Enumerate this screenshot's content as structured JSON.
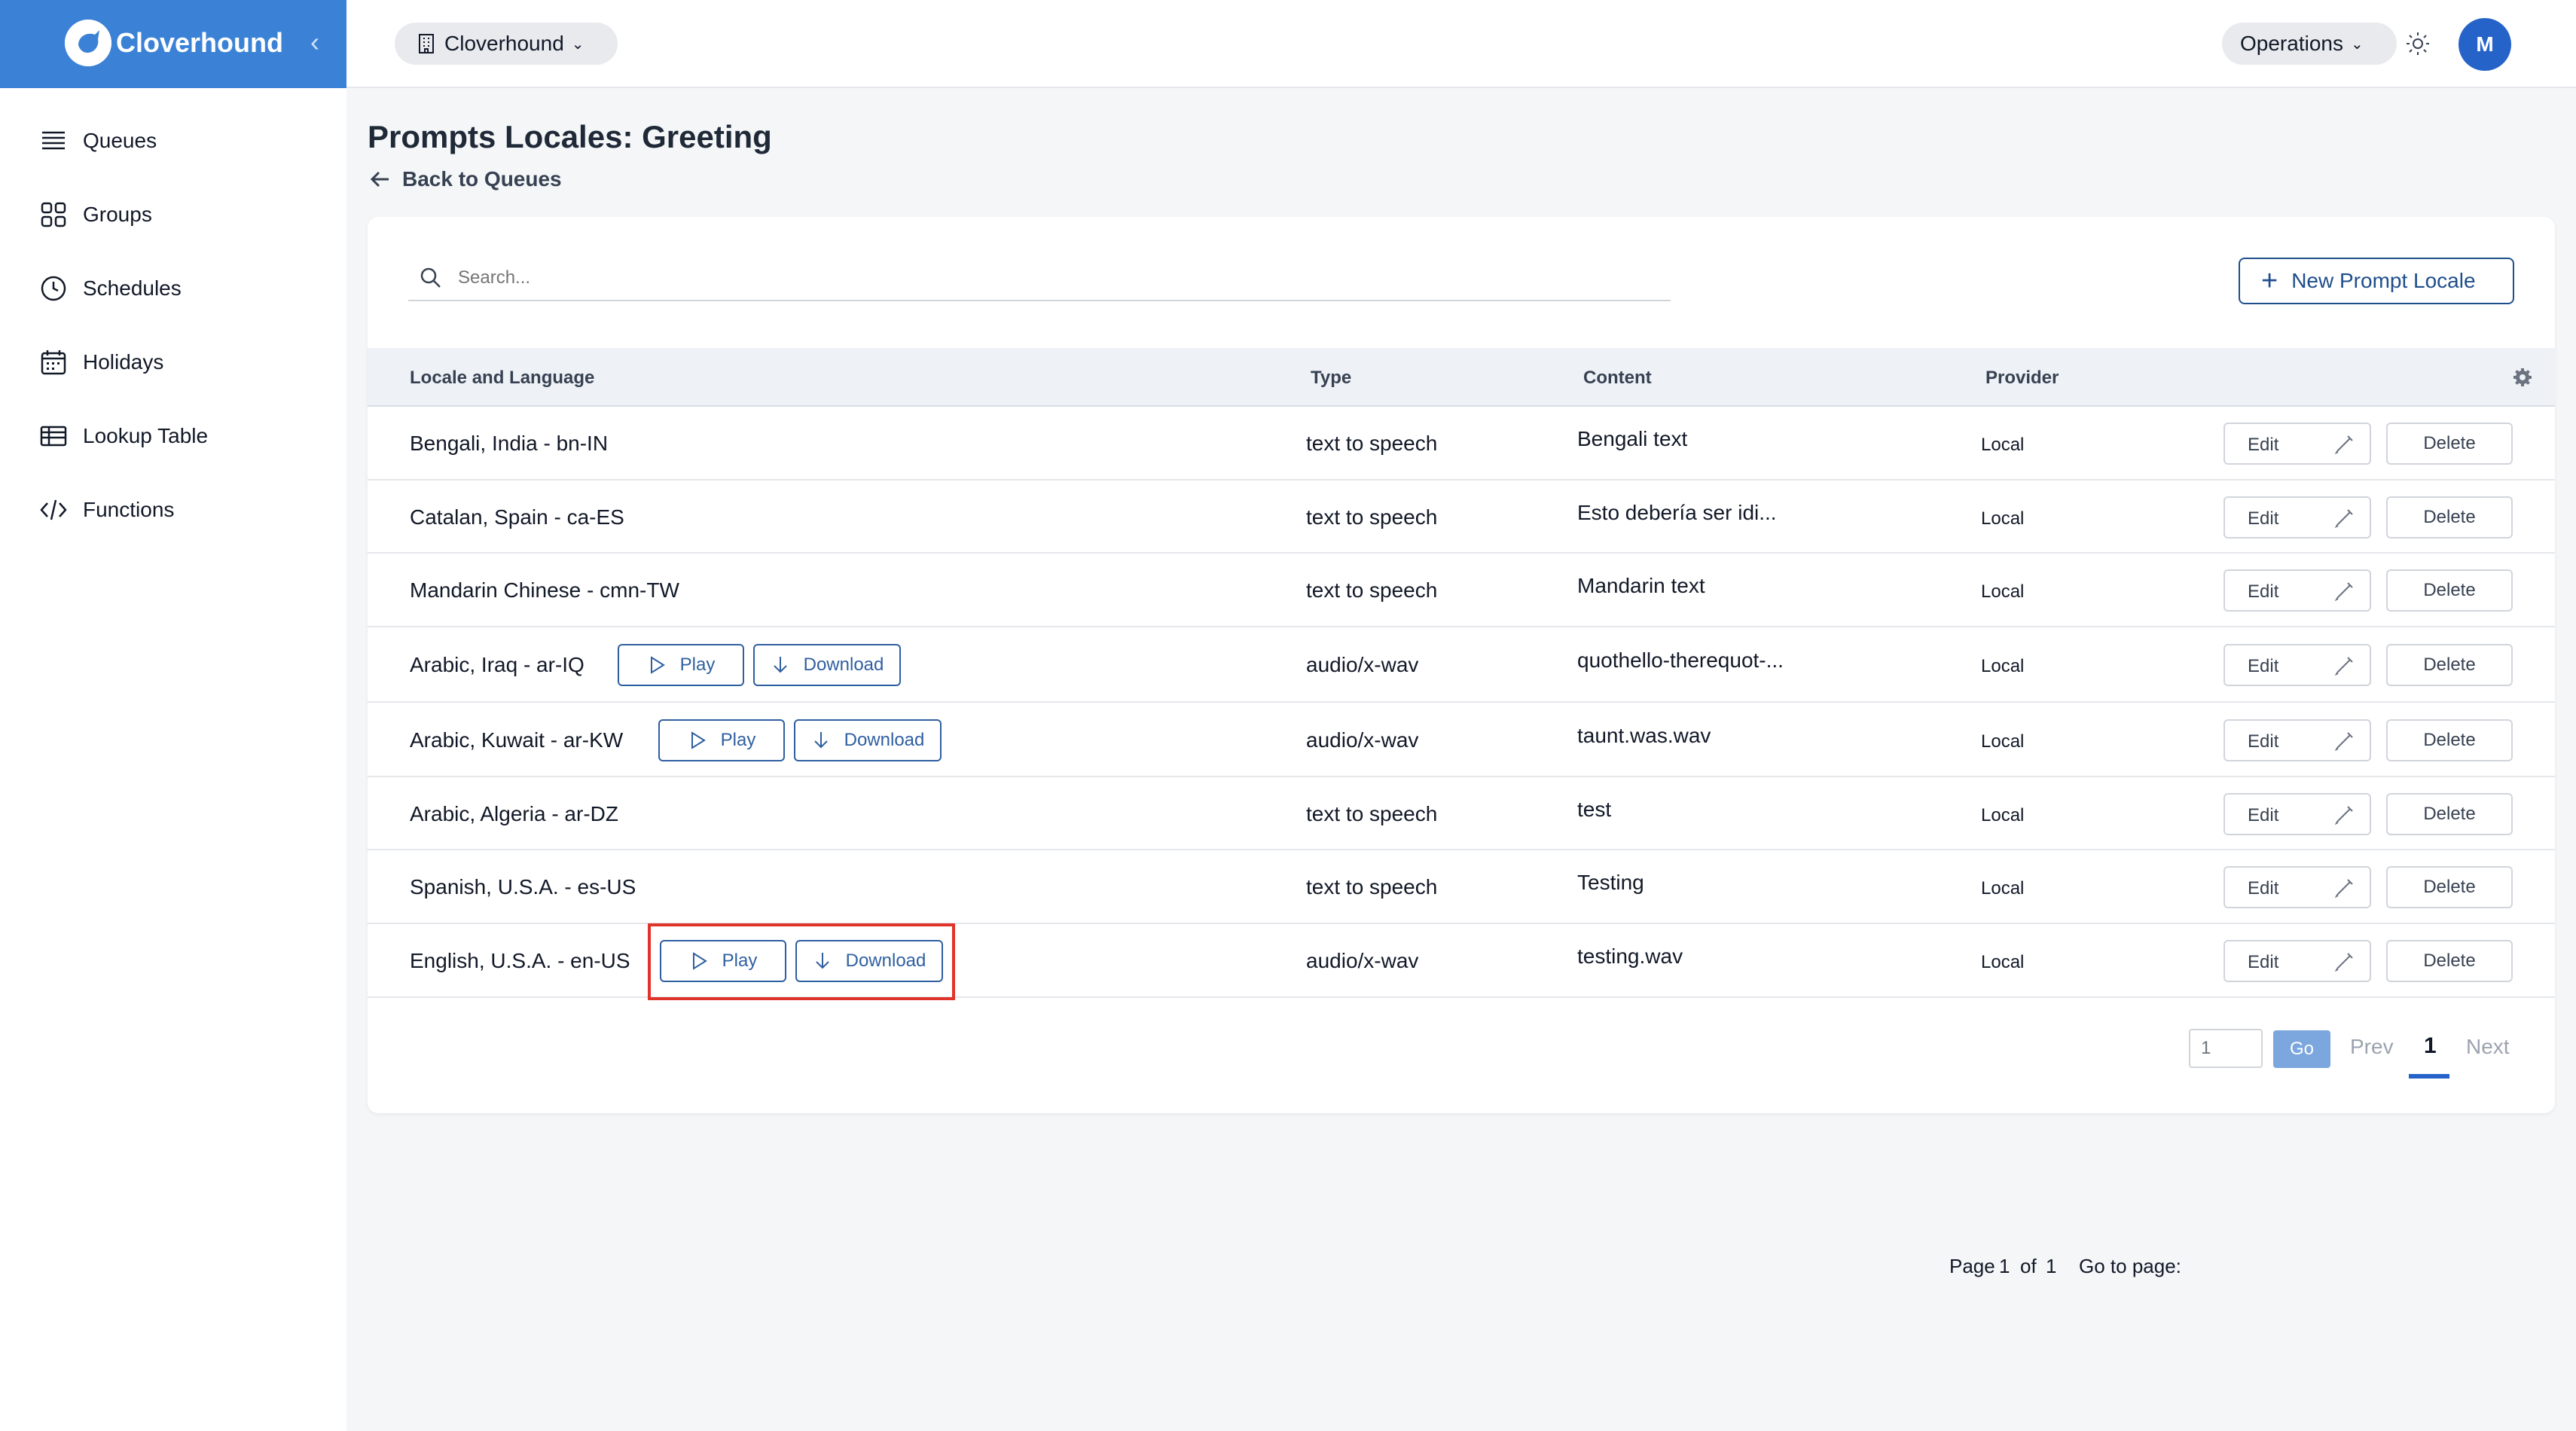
{
  "app": {
    "brand": "Cloverhound",
    "org_selector": "Cloverhound",
    "ops_selector": "Operations",
    "avatar_initial": "M"
  },
  "sidebar": {
    "items": [
      {
        "label": "Queues",
        "icon": "list-icon"
      },
      {
        "label": "Groups",
        "icon": "grid-icon"
      },
      {
        "label": "Schedules",
        "icon": "clock-icon"
      },
      {
        "label": "Holidays",
        "icon": "calendar-icon"
      },
      {
        "label": "Lookup Table",
        "icon": "table-icon"
      },
      {
        "label": "Functions",
        "icon": "code-icon"
      }
    ]
  },
  "page": {
    "title": "Prompts Locales: Greeting",
    "back_label": "Back to Queues"
  },
  "toolbar": {
    "search_placeholder": "Search...",
    "new_button_label": "New Prompt Locale"
  },
  "table": {
    "columns": [
      "Locale and Language",
      "Type",
      "Content",
      "Provider"
    ],
    "rows": [
      {
        "locale": "Bengali, India - bn-IN",
        "type": "text to speech",
        "content": "Bengali text",
        "provider": "Local",
        "audio": false
      },
      {
        "locale": "Catalan, Spain - ca-ES",
        "type": "text to speech",
        "content": "Esto debería ser idi...",
        "provider": "Local",
        "audio": false
      },
      {
        "locale": "Mandarin Chinese - cmn-TW",
        "type": "text to speech",
        "content": "Mandarin text",
        "provider": "Local",
        "audio": false
      },
      {
        "locale": "Arabic, Iraq - ar-IQ",
        "type": "audio/x-wav",
        "content": "quothello-therequot-...",
        "provider": "Local",
        "audio": true
      },
      {
        "locale": "Arabic, Kuwait - ar-KW",
        "type": "audio/x-wav",
        "content": "taunt.was.wav",
        "provider": "Local",
        "audio": true
      },
      {
        "locale": "Arabic, Algeria - ar-DZ",
        "type": "text to speech",
        "content": "test",
        "provider": "Local",
        "audio": false
      },
      {
        "locale": "Spanish, U.S.A. - es-US",
        "type": "text to speech",
        "content": "Testing",
        "provider": "Local",
        "audio": false
      },
      {
        "locale": "English, U.S.A. - en-US",
        "type": "audio/x-wav",
        "content": "testing.wav",
        "provider": "Local",
        "audio": true
      }
    ],
    "actions": {
      "play": "Play",
      "download": "Download",
      "edit": "Edit",
      "delete": "Delete"
    }
  },
  "pagination": {
    "page_label": "Page",
    "current_page": "1",
    "of_label": "of",
    "total_pages": "1",
    "goto_label": "Go to page:",
    "goto_value": "1",
    "go_label": "Go",
    "prev_label": "Prev",
    "next_label": "Next"
  },
  "colors": {
    "brand": "#3b82d6",
    "primary": "#1f4e8c",
    "highlight": "#e0342a"
  }
}
